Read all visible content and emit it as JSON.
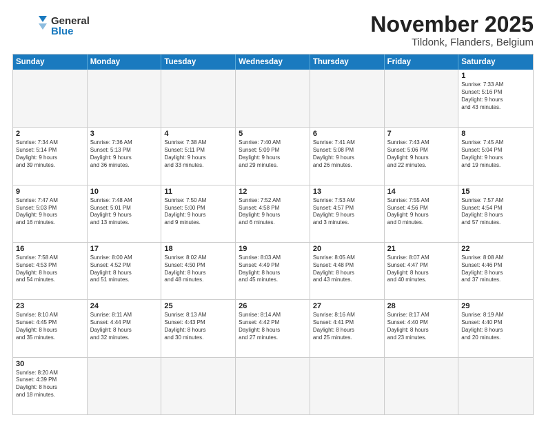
{
  "header": {
    "logo_general": "General",
    "logo_blue": "Blue",
    "month": "November 2025",
    "location": "Tildonk, Flanders, Belgium"
  },
  "weekdays": [
    "Sunday",
    "Monday",
    "Tuesday",
    "Wednesday",
    "Thursday",
    "Friday",
    "Saturday"
  ],
  "rows": [
    [
      {
        "day": "",
        "info": "",
        "empty": true
      },
      {
        "day": "",
        "info": "",
        "empty": true
      },
      {
        "day": "",
        "info": "",
        "empty": true
      },
      {
        "day": "",
        "info": "",
        "empty": true
      },
      {
        "day": "",
        "info": "",
        "empty": true
      },
      {
        "day": "",
        "info": "",
        "empty": true
      },
      {
        "day": "1",
        "info": "Sunrise: 7:33 AM\nSunset: 5:16 PM\nDaylight: 9 hours\nand 43 minutes."
      }
    ],
    [
      {
        "day": "2",
        "info": "Sunrise: 7:34 AM\nSunset: 5:14 PM\nDaylight: 9 hours\nand 39 minutes."
      },
      {
        "day": "3",
        "info": "Sunrise: 7:36 AM\nSunset: 5:13 PM\nDaylight: 9 hours\nand 36 minutes."
      },
      {
        "day": "4",
        "info": "Sunrise: 7:38 AM\nSunset: 5:11 PM\nDaylight: 9 hours\nand 33 minutes."
      },
      {
        "day": "5",
        "info": "Sunrise: 7:40 AM\nSunset: 5:09 PM\nDaylight: 9 hours\nand 29 minutes."
      },
      {
        "day": "6",
        "info": "Sunrise: 7:41 AM\nSunset: 5:08 PM\nDaylight: 9 hours\nand 26 minutes."
      },
      {
        "day": "7",
        "info": "Sunrise: 7:43 AM\nSunset: 5:06 PM\nDaylight: 9 hours\nand 22 minutes."
      },
      {
        "day": "8",
        "info": "Sunrise: 7:45 AM\nSunset: 5:04 PM\nDaylight: 9 hours\nand 19 minutes."
      }
    ],
    [
      {
        "day": "9",
        "info": "Sunrise: 7:47 AM\nSunset: 5:03 PM\nDaylight: 9 hours\nand 16 minutes."
      },
      {
        "day": "10",
        "info": "Sunrise: 7:48 AM\nSunset: 5:01 PM\nDaylight: 9 hours\nand 13 minutes."
      },
      {
        "day": "11",
        "info": "Sunrise: 7:50 AM\nSunset: 5:00 PM\nDaylight: 9 hours\nand 9 minutes."
      },
      {
        "day": "12",
        "info": "Sunrise: 7:52 AM\nSunset: 4:58 PM\nDaylight: 9 hours\nand 6 minutes."
      },
      {
        "day": "13",
        "info": "Sunrise: 7:53 AM\nSunset: 4:57 PM\nDaylight: 9 hours\nand 3 minutes."
      },
      {
        "day": "14",
        "info": "Sunrise: 7:55 AM\nSunset: 4:56 PM\nDaylight: 9 hours\nand 0 minutes."
      },
      {
        "day": "15",
        "info": "Sunrise: 7:57 AM\nSunset: 4:54 PM\nDaylight: 8 hours\nand 57 minutes."
      }
    ],
    [
      {
        "day": "16",
        "info": "Sunrise: 7:58 AM\nSunset: 4:53 PM\nDaylight: 8 hours\nand 54 minutes."
      },
      {
        "day": "17",
        "info": "Sunrise: 8:00 AM\nSunset: 4:52 PM\nDaylight: 8 hours\nand 51 minutes."
      },
      {
        "day": "18",
        "info": "Sunrise: 8:02 AM\nSunset: 4:50 PM\nDaylight: 8 hours\nand 48 minutes."
      },
      {
        "day": "19",
        "info": "Sunrise: 8:03 AM\nSunset: 4:49 PM\nDaylight: 8 hours\nand 45 minutes."
      },
      {
        "day": "20",
        "info": "Sunrise: 8:05 AM\nSunset: 4:48 PM\nDaylight: 8 hours\nand 43 minutes."
      },
      {
        "day": "21",
        "info": "Sunrise: 8:07 AM\nSunset: 4:47 PM\nDaylight: 8 hours\nand 40 minutes."
      },
      {
        "day": "22",
        "info": "Sunrise: 8:08 AM\nSunset: 4:46 PM\nDaylight: 8 hours\nand 37 minutes."
      }
    ],
    [
      {
        "day": "23",
        "info": "Sunrise: 8:10 AM\nSunset: 4:45 PM\nDaylight: 8 hours\nand 35 minutes."
      },
      {
        "day": "24",
        "info": "Sunrise: 8:11 AM\nSunset: 4:44 PM\nDaylight: 8 hours\nand 32 minutes."
      },
      {
        "day": "25",
        "info": "Sunrise: 8:13 AM\nSunset: 4:43 PM\nDaylight: 8 hours\nand 30 minutes."
      },
      {
        "day": "26",
        "info": "Sunrise: 8:14 AM\nSunset: 4:42 PM\nDaylight: 8 hours\nand 27 minutes."
      },
      {
        "day": "27",
        "info": "Sunrise: 8:16 AM\nSunset: 4:41 PM\nDaylight: 8 hours\nand 25 minutes."
      },
      {
        "day": "28",
        "info": "Sunrise: 8:17 AM\nSunset: 4:40 PM\nDaylight: 8 hours\nand 23 minutes."
      },
      {
        "day": "29",
        "info": "Sunrise: 8:19 AM\nSunset: 4:40 PM\nDaylight: 8 hours\nand 20 minutes."
      }
    ],
    [
      {
        "day": "30",
        "info": "Sunrise: 8:20 AM\nSunset: 4:39 PM\nDaylight: 8 hours\nand 18 minutes."
      },
      {
        "day": "",
        "info": "",
        "empty": true
      },
      {
        "day": "",
        "info": "",
        "empty": true
      },
      {
        "day": "",
        "info": "",
        "empty": true
      },
      {
        "day": "",
        "info": "",
        "empty": true
      },
      {
        "day": "",
        "info": "",
        "empty": true
      },
      {
        "day": "",
        "info": "",
        "empty": true
      }
    ]
  ]
}
